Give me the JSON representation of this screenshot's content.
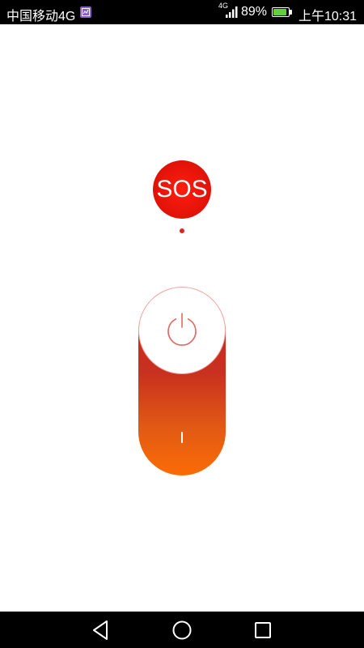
{
  "status_bar": {
    "carrier": "中国移动4G",
    "network_type": "4G",
    "battery_percent": "89%",
    "battery_level": 0.89,
    "time": "上午10:31",
    "icons": [
      "notification-app-icon",
      "signal-icon",
      "battery-icon"
    ],
    "battery_color": "#5fd13c"
  },
  "sos": {
    "label": "SOS",
    "color": "#e11208"
  },
  "slider": {
    "state": "off",
    "knob_icon": "power-icon",
    "indicator_icon": "on-indicator-icon",
    "gradient_top": "#d0281c",
    "gradient_bottom": "#fb6c06"
  },
  "nav_bar": {
    "buttons": [
      "back-icon",
      "home-icon",
      "recent-apps-icon"
    ]
  }
}
